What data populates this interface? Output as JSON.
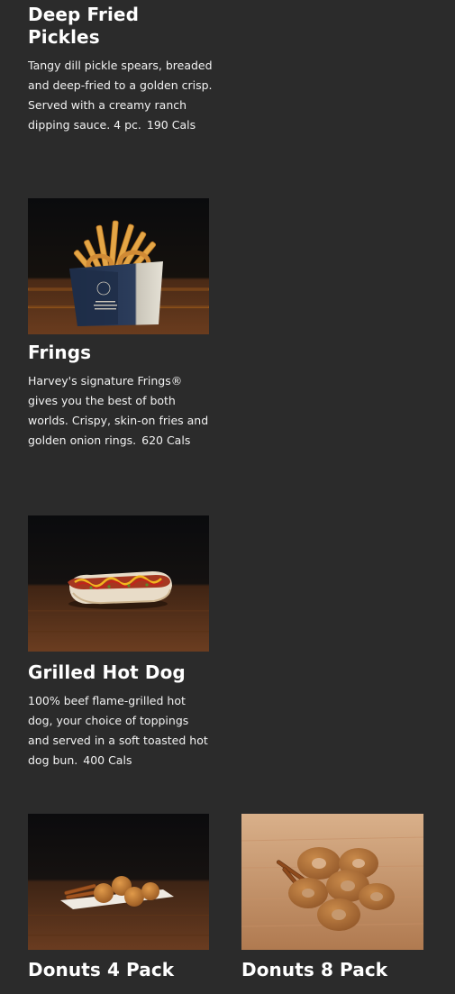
{
  "menu_items": [
    {
      "title": "Deep Fried Pickles",
      "description": "Tangy dill pickle spears, breaded and deep-fried to a golden crisp. Served with a creamy ranch dipping sauce. 4 pc.",
      "calories": "190 Cals"
    },
    {
      "title": "Frings",
      "description": "Harvey's signature Frings® gives you the best of both worlds. Crispy, skin-on fries and golden onion rings.",
      "calories": "620 Cals"
    },
    {
      "title": "Grilled Hot Dog",
      "description": "100% beef flame-grilled hot dog, your choice of toppings and served in a soft toasted hot dog bun.",
      "calories": "400 Cals"
    },
    {
      "title": "Donuts 4 Pack"
    },
    {
      "title": "Donuts 8 Pack"
    }
  ],
  "colors": {
    "background": "#2b2b2b",
    "text": "#ffffff"
  }
}
